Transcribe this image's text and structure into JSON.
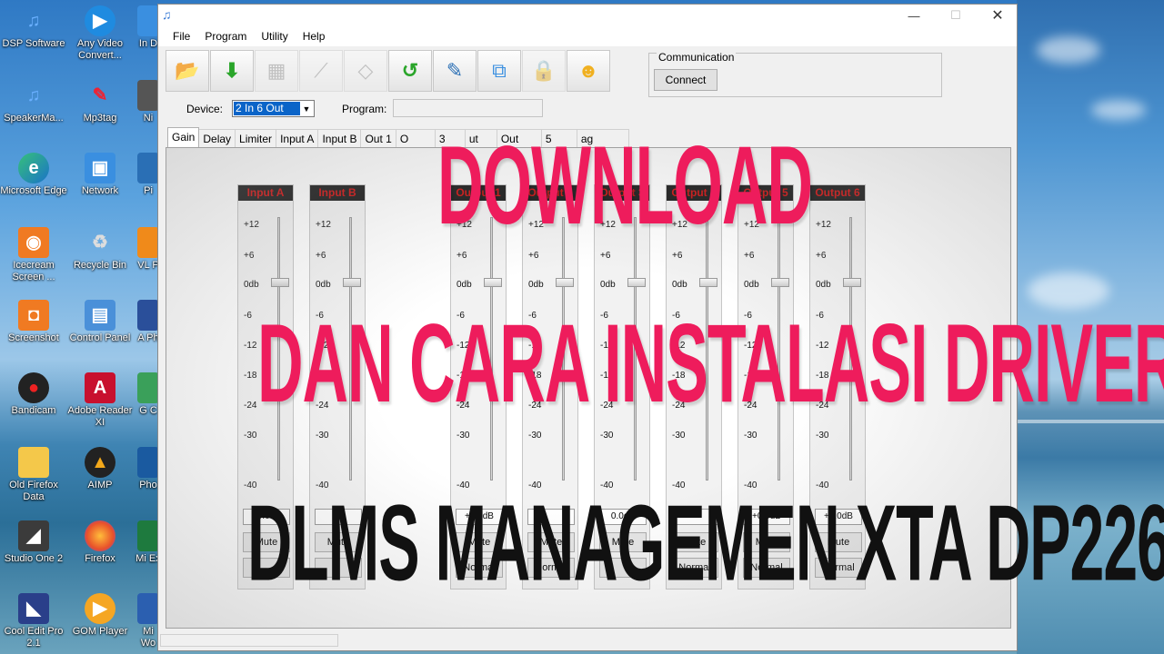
{
  "desktop": {
    "icons_col1": [
      "DSP Software",
      "SpeakerMa...",
      "Microsoft Edge",
      "Icecream Screen ...",
      "Screenshot",
      "Bandicam",
      "Old Firefox Data",
      "Studio One 2",
      "Cool Edit Pro 2.1"
    ],
    "icons_col2": [
      "Any Video Convert...",
      "Mp3tag",
      "Network",
      "Recycle Bin",
      "Control Panel",
      "Adobe Reader XI",
      "AIMP",
      "Firefox",
      "GOM Player"
    ],
    "icons_col3": [
      "In D",
      "Ni",
      "Pi",
      "VL P",
      "A Ph",
      "G C",
      "Pho",
      "Mi Ex",
      "Mi Wo"
    ]
  },
  "window": {
    "menu": [
      "File",
      "Program",
      "Utility",
      "Help"
    ],
    "toolbar_icons": [
      "open-folder-icon",
      "download-icon",
      "grid-icon",
      "routing-icon",
      "eraser-icon",
      "upload-icon",
      "edit-icon",
      "network-icon",
      "lock-icon",
      "smiley-icon"
    ],
    "communication": {
      "title": "Communication",
      "connect_label": "Connect"
    },
    "device_label": "Device:",
    "device_value": "2 In 6 Out",
    "program_label": "Program:",
    "tabs": [
      "Gain",
      "Delay",
      "Limiter",
      "Input A",
      "Input B",
      "Out 1",
      "O",
      "3",
      "ut",
      "Out",
      "5",
      "ag"
    ],
    "active_tab": "Gain",
    "strips": [
      {
        "name": "Input A",
        "level": "+0.0dB",
        "mute": "Mute",
        "mode": ""
      },
      {
        "name": "Input B",
        "level": "",
        "mute": "Mute",
        "mode": ""
      },
      {
        "name": "Output 1",
        "level": "+0.0dB",
        "mute": "Mute",
        "mode": "Normal"
      },
      {
        "name": "Output 2",
        "level": "",
        "mute": "Mute",
        "mode": "Normal"
      },
      {
        "name": "Output 3",
        "level": "0.0dB",
        "mute": "Mute",
        "mode": ""
      },
      {
        "name": "Output 4",
        "level": "",
        "mute": "Mute",
        "mode": "Normal"
      },
      {
        "name": "Output 5",
        "level": "+0.0dB",
        "mute": "Mute",
        "mode": "Normal"
      },
      {
        "name": "Output 6",
        "level": "+0.0dB",
        "mute": "Mute",
        "mode": "Normal"
      }
    ],
    "scale_labels": [
      "+12",
      "+6",
      "0db",
      "-6",
      "-12",
      "-18",
      "-24",
      "-30",
      "-40"
    ]
  },
  "overlay": {
    "line1": "DOWNLOAD",
    "line2": "DAN CARA INSTALASI DRIVER",
    "line3": "DLMS MANAGEMEN XTA DP226"
  }
}
